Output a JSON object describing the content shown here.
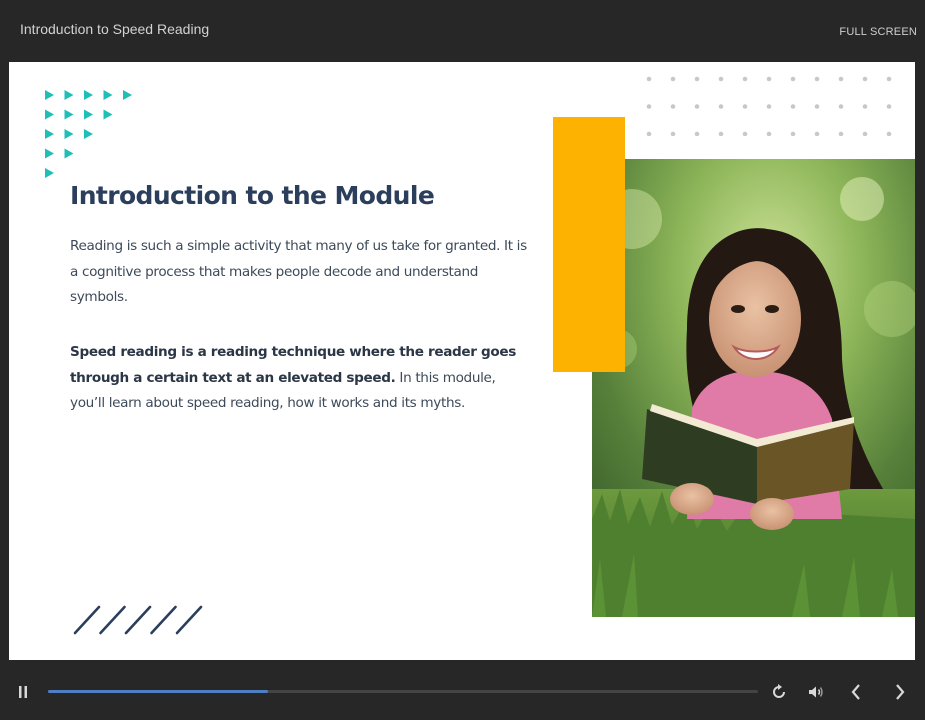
{
  "player": {
    "course_title": "Introduction to Speed Reading",
    "fullscreen_label": "FULL SCREEN"
  },
  "slide": {
    "heading": "Introduction to the Module",
    "paragraph1": "Reading is such a simple activity that many of us take for granted. It is a cognitive process that makes people decode and understand symbols.",
    "paragraph2_bold": "Speed reading is a reading technique where the reader goes through a certain text at an elevated speed.",
    "paragraph2_rest": " In this module, you’ll learn about speed reading, how it works and its myths.",
    "colors": {
      "heading": "#2b3f5c",
      "accent_yellow": "#fdb100",
      "accent_teal": "#1fbfb8",
      "dots": "#c8c8c8"
    },
    "decorations": {
      "triangle_rows": [
        5,
        4,
        3,
        2,
        1
      ],
      "dot_grid_rows": 3,
      "dot_grid_cols": 11,
      "slash_count": 5
    }
  },
  "controls": {
    "progress": 0.31,
    "icons": {
      "pause": "pause-icon",
      "replay": "replay-icon",
      "volume": "volume-icon",
      "previous": "chevron-left-icon",
      "next": "chevron-right-icon"
    }
  }
}
